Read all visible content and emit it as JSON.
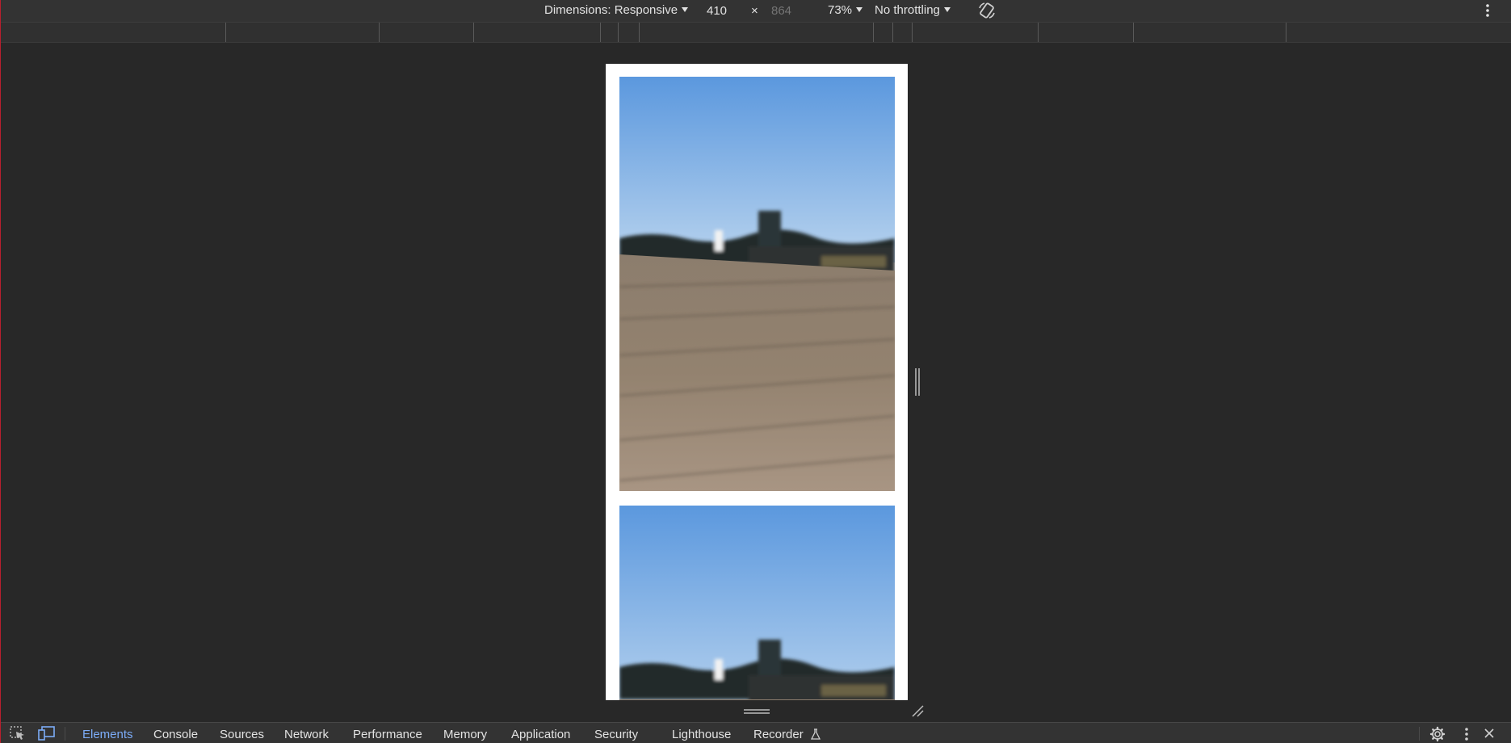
{
  "device_toolbar": {
    "dimensions_label": "Dimensions: Responsive",
    "width_value": "410",
    "times_sign": "×",
    "height_placeholder": "864",
    "zoom_label": "73%",
    "throttling_label": "No throttling",
    "rotate_icon": "rotate-icon",
    "more_icon": "kebab-menu-icon"
  },
  "viewport": {
    "images": [
      {
        "name": "pier-photo-1",
        "description_icon": "image"
      },
      {
        "name": "pier-photo-2",
        "description_icon": "image"
      }
    ]
  },
  "devtools_tabs": {
    "inspect_icon": "inspect-element-icon",
    "device_icon": "device-toggle-icon",
    "items": [
      {
        "label": "Elements",
        "active": true
      },
      {
        "label": "Console",
        "active": false
      },
      {
        "label": "Sources",
        "active": false
      },
      {
        "label": "Network",
        "active": false
      },
      {
        "label": "Performance",
        "active": false
      },
      {
        "label": "Memory",
        "active": false
      },
      {
        "label": "Application",
        "active": false
      },
      {
        "label": "Security",
        "active": false
      },
      {
        "label": "Lighthouse",
        "active": false
      },
      {
        "label": "Recorder",
        "active": false
      }
    ],
    "recorder_badge_icon": "flask-icon",
    "settings_icon": "gear-icon",
    "more_icon": "kebab-menu-icon",
    "close_icon": "close-icon"
  },
  "colors": {
    "background": "#282828",
    "toolbar": "#333333",
    "active_tab": "#7cacf8",
    "text": "#e3e3e3",
    "placeholder": "#7a7a7a"
  }
}
